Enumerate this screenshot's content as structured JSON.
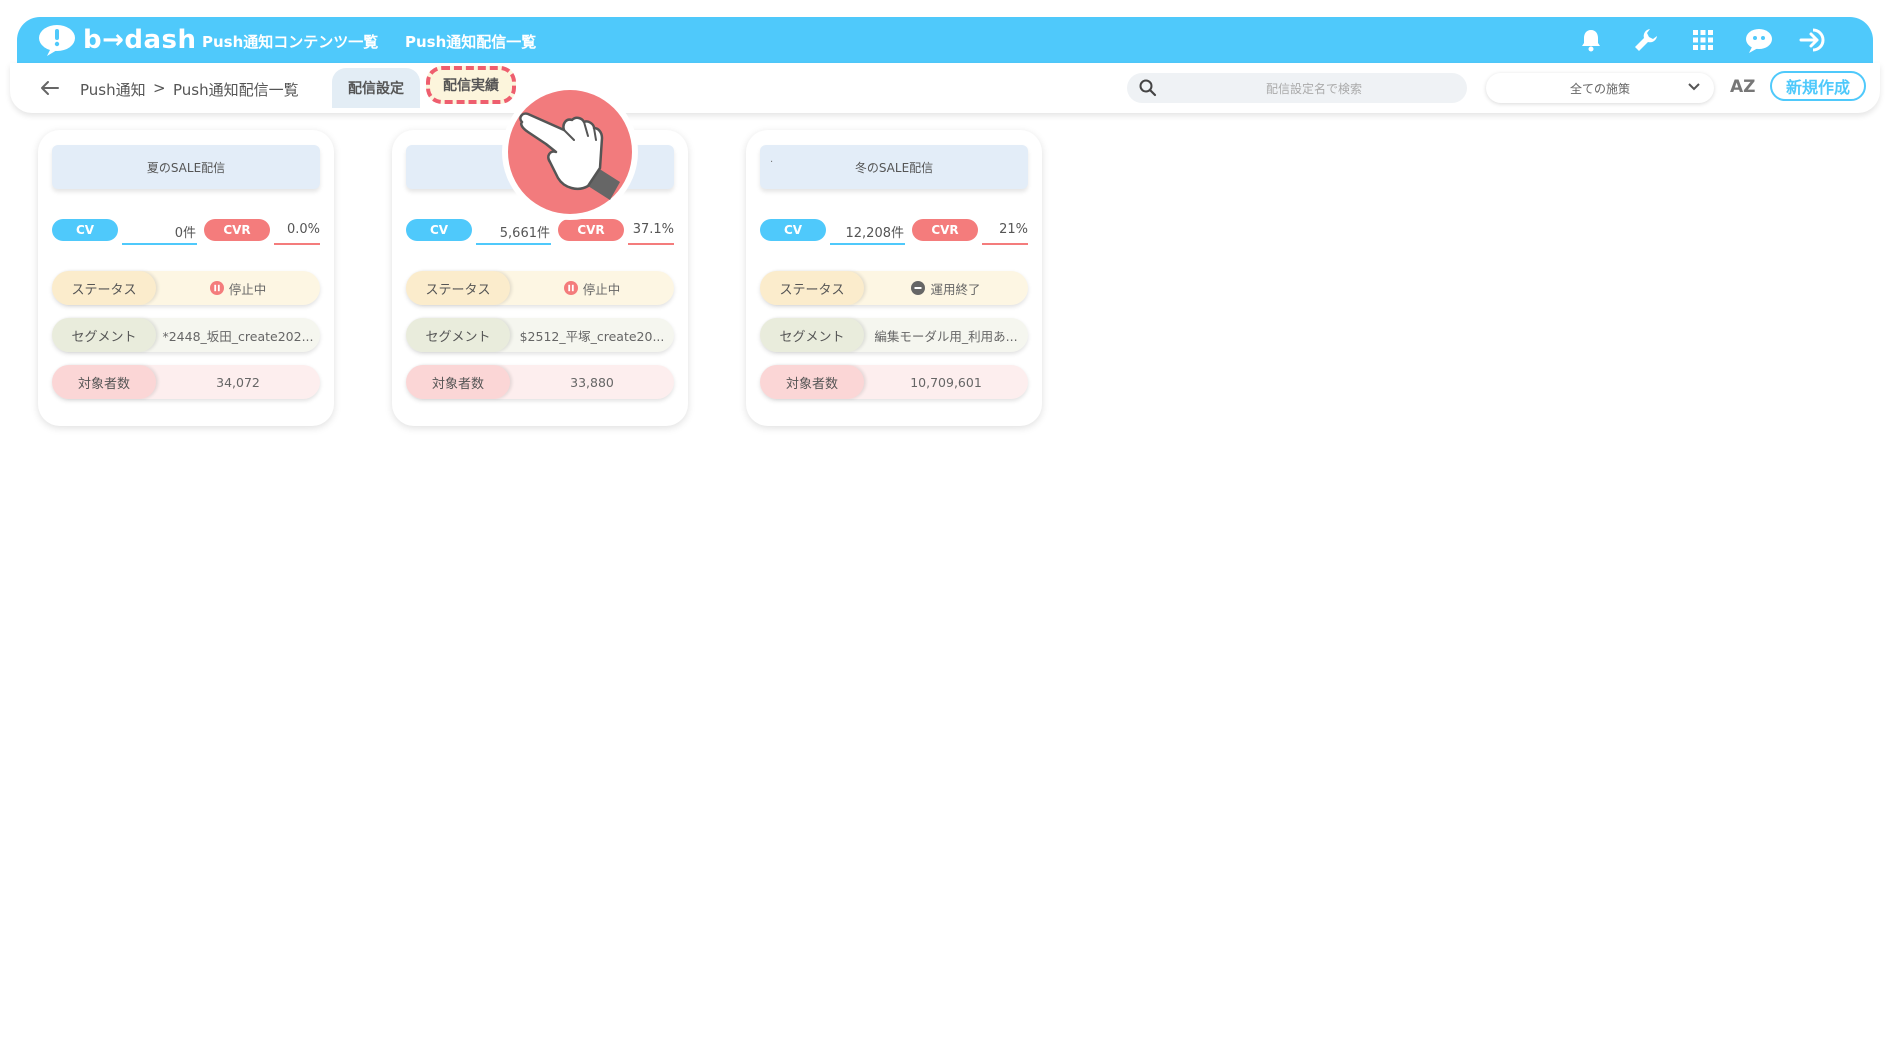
{
  "header": {
    "logo_text": "b→dash",
    "nav": [
      {
        "label": "Push通知コンテンツ一覧"
      },
      {
        "label": "Push通知配信一覧"
      }
    ],
    "icons": [
      "bell-icon",
      "wrench-icon",
      "grid-icon",
      "chat-robot-icon",
      "logout-icon"
    ]
  },
  "subbar": {
    "breadcrumb": {
      "root": "Push通知",
      "separator": ">",
      "current": "Push通知配信一覧"
    },
    "tabs": [
      {
        "label": "配信設定",
        "state": "active"
      },
      {
        "label": "配信実績",
        "state": "highlighted"
      }
    ],
    "search": {
      "placeholder": "配信設定名で検索"
    },
    "filter": {
      "selected": "全ての施策"
    },
    "sort_label": "AZ",
    "new_button": "新規作成"
  },
  "labels": {
    "cv": "CV",
    "cvr": "CVR",
    "status": "ステータス",
    "segment": "セグメント",
    "target_count": "対象者数"
  },
  "cards": [
    {
      "title": "夏のSALE配信",
      "title_prefix": "",
      "cv": "0件",
      "cvr": "0.0%",
      "status": "停止中",
      "status_icon": "pause-icon",
      "segment": "*2448_坂田_create202...",
      "target_count": "34,072"
    },
    {
      "title": "",
      "title_prefix": "",
      "cv": "5,661件",
      "cvr": "37.1%",
      "status": "停止中",
      "status_icon": "pause-icon",
      "segment": "$2512_平塚_create20...",
      "target_count": "33,880"
    },
    {
      "title": "冬のSALE配信",
      "title_prefix": "·",
      "cv": "12,208件",
      "cvr": "21%",
      "status": "運用終了",
      "status_icon": "minus-circle-icon",
      "segment": "編集モーダル用_利用あ...",
      "target_count": "10,709,601"
    }
  ],
  "colors": {
    "brand": "#4fc9fb",
    "cvr": "#f47c7c",
    "highlight_border": "#ee5e6e"
  }
}
